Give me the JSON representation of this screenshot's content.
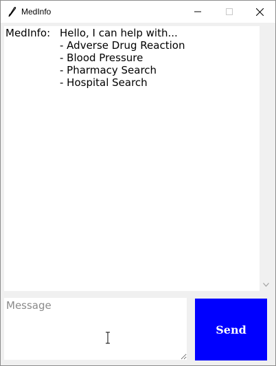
{
  "window": {
    "title": "MedInfo"
  },
  "chat": {
    "speaker": "MedInfo:",
    "greeting": "Hello, I can help with...",
    "options": [
      "- Adverse Drug Reaction",
      "- Blood Pressure",
      "- Pharmacy Search",
      "- Hospital Search"
    ]
  },
  "input": {
    "placeholder": "Message",
    "value": ""
  },
  "send": {
    "label": "Send",
    "color": "#0000ff"
  },
  "icons": {
    "app": "feather-icon",
    "minimize": "minimize-icon",
    "maximize": "maximize-icon",
    "close": "close-icon",
    "scroll_down": "chevron-down-icon",
    "text_cursor": "ibeam-cursor-icon"
  }
}
